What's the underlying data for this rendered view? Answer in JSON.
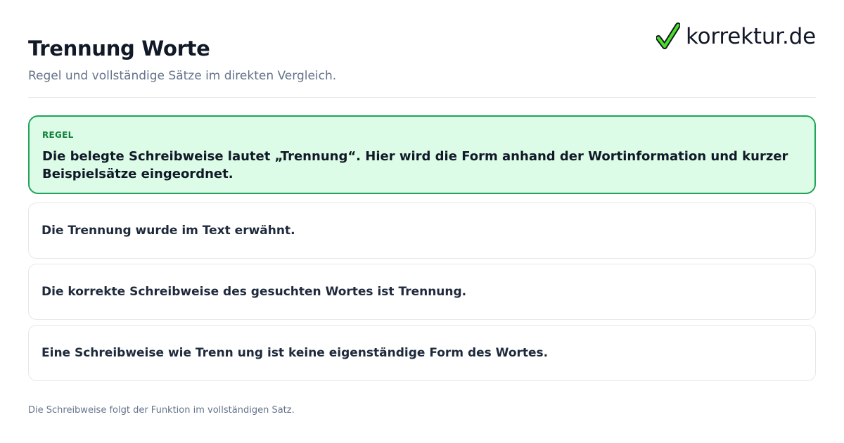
{
  "header": {
    "title": "Trennung Worte",
    "subtitle": "Regel und vollständige Sätze im direkten Vergleich."
  },
  "logo": {
    "text": "korrektur.de",
    "icon": "checkmark-icon",
    "icon_color": "#4ade24"
  },
  "rule": {
    "label": "REGEL",
    "text": "Die belegte Schreibweise lautet „Trennung“. Hier wird die Form anhand der Wortinformation und kurzer Beispielsätze eingeordnet."
  },
  "examples": [
    "Die Trennung wurde im Text erwähnt.",
    "Die korrekte Schreibweise des gesuchten Wortes ist Trennung.",
    "Eine Schreibweise wie Trenn ung ist keine eigenständige Form des Wortes."
  ],
  "footer": "Die Schreibweise folgt der Funktion im vollständigen Satz.",
  "colors": {
    "accent_green": "#22a35a",
    "rule_background": "#dcfce7"
  }
}
